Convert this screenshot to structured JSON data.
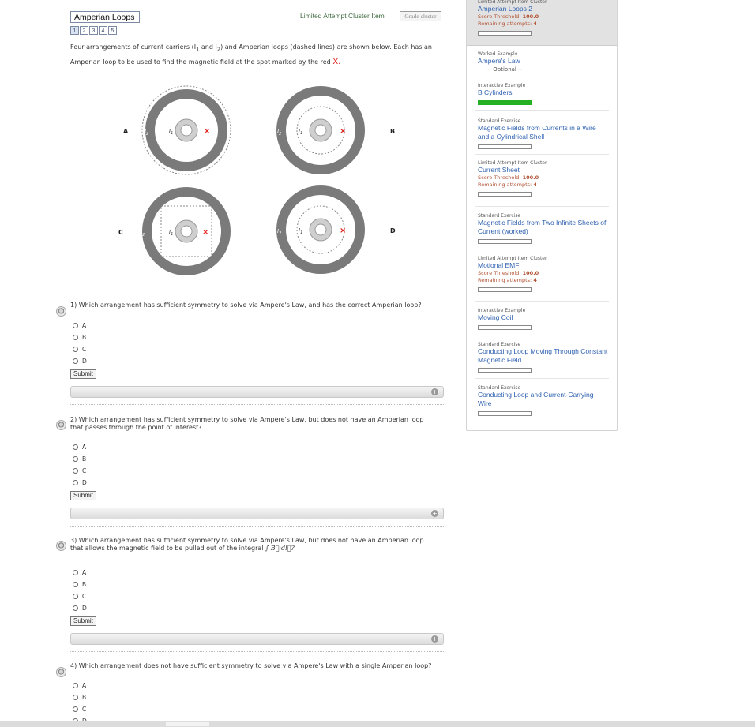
{
  "header": {
    "title": "Amperian Loops 2",
    "cluster_label": "Limited Attempt Cluster Item",
    "grade_button": "Grade cluster",
    "pages": [
      "1",
      "2",
      "3",
      "4",
      "5"
    ]
  },
  "intro": {
    "line1": "Four arrangements of current carriers (I",
    "sub1": "1",
    "mid": " and I",
    "sub2": "2",
    "line1_end": ") and Amperian loops (dashed lines) are shown below. Each has an",
    "line2": "Amperian loop to be used to find the magnetic field at the spot marked by the red ",
    "red_mark": "X."
  },
  "figure": {
    "labels": [
      "A",
      "B",
      "C",
      "D"
    ],
    "i1": "I",
    "i1_sub": "1",
    "i2": "I",
    "i2_sub": "2",
    "x_mark": "×",
    "colors": {
      "shell": "#7a7a7a",
      "wire": "#cfcfcf",
      "loop": "#888888",
      "mark": "#e0231b"
    }
  },
  "questions": [
    {
      "text": "1) Which arrangement has sufficient symmetry to solve via Ampere's Law, and has the correct Amperian loop?",
      "options": [
        "A",
        "B",
        "C",
        "D"
      ],
      "submit": "Submit"
    },
    {
      "text": "2) Which arrangement has sufficient symmetry to solve via Ampere's Law, but does not have an Amperian loop that passes through the point of interest?",
      "options": [
        "A",
        "B",
        "C",
        "D"
      ],
      "submit": "Submit"
    },
    {
      "text": "3) Which arrangement has sufficient symmetry to solve via Ampere's Law, but does not have an Amperian loop that allows the magnetic field to be pulled out of the integral ",
      "integral": "∫ B⃗·dl⃗?",
      "options": [
        "A",
        "B",
        "C",
        "D"
      ],
      "submit": "Submit"
    },
    {
      "text": "4) Which arrangement does not have sufficient symmetry to solve via Ampere's Law with a single Amperian loop?",
      "options": [
        "A",
        "B",
        "C",
        "D"
      ]
    }
  ],
  "sidebar": {
    "items": [
      {
        "type": "Limited Attempt Item Cluster",
        "title": "Amperian Loops 2",
        "threshold_label": "Score Threshold: ",
        "threshold": "100.0",
        "attempts_label": "Remaining attempts: ",
        "attempts": "4",
        "progress": 0
      },
      {
        "type": "Worked Example",
        "title": "Ampere's Law",
        "optional": "-- Optional --"
      },
      {
        "type": "Interactive Example",
        "title": "B Cylinders",
        "progress": 1
      },
      {
        "type": "Standard Exercise",
        "title": "Magnetic Fields from Currents in a Wire and a Cylindrical Shell",
        "progress": 0
      },
      {
        "type": "Limited Attempt Item Cluster",
        "title": "Current Sheet",
        "threshold_label": "Score Threshold: ",
        "threshold": "100.0",
        "attempts_label": "Remaining attempts: ",
        "attempts": "4",
        "progress": 0
      },
      {
        "type": "Standard Exercise",
        "title": "Magnetic Fields from Two Infinite Sheets of Current (worked)",
        "progress": 0
      },
      {
        "type": "Limited Attempt Item Cluster",
        "title": "Motional EMF",
        "threshold_label": "Score Threshold: ",
        "threshold": "100.0",
        "attempts_label": "Remaining attempts: ",
        "attempts": "4",
        "progress": 0
      },
      {
        "type": "Interactive Example",
        "title": "Moving Coil",
        "progress": 0
      },
      {
        "type": "Standard Exercise",
        "title": "Conducting Loop Moving Through Constant Magnetic Field",
        "progress": 0
      },
      {
        "type": "Standard Exercise",
        "title": "Conducting Loop and Current-Carrying Wire",
        "progress": 0
      }
    ]
  }
}
